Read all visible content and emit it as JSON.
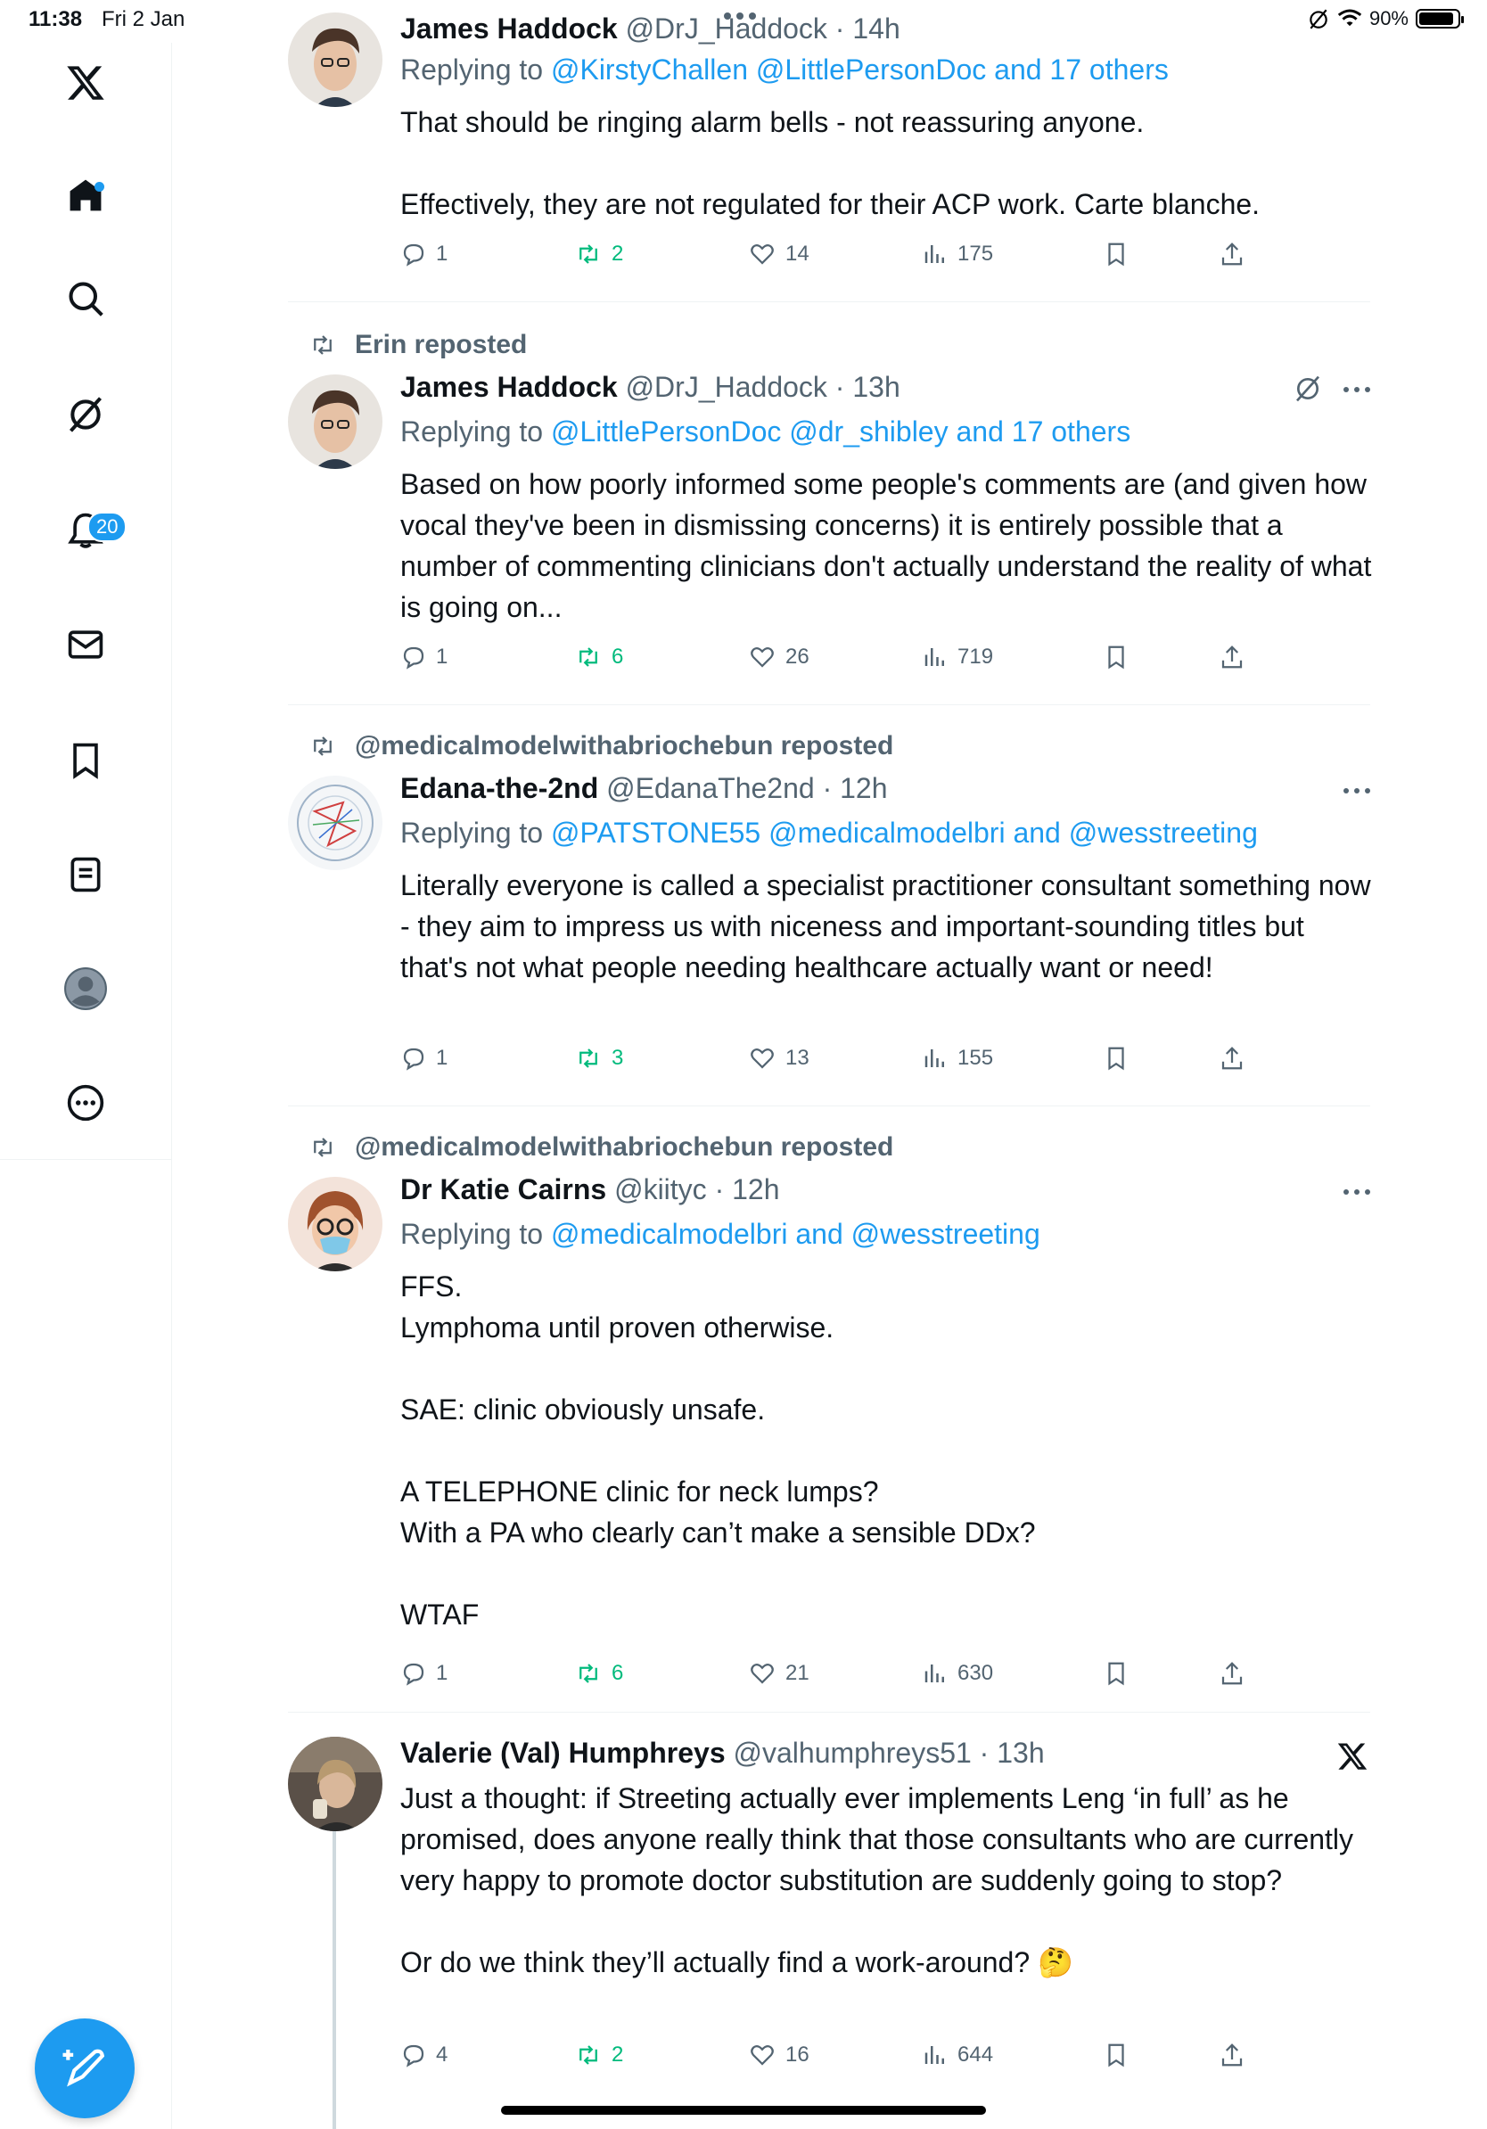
{
  "status_bar": {
    "time": "11:38",
    "date": "Fri 2 Jan",
    "battery": "90%"
  },
  "sidebar": {
    "notifications_badge": "20",
    "items": [
      {
        "name": "x-logo-icon"
      },
      {
        "name": "home-icon"
      },
      {
        "name": "search-icon"
      },
      {
        "name": "grok-icon"
      },
      {
        "name": "notifications-icon"
      },
      {
        "name": "messages-icon"
      },
      {
        "name": "bookmarks-icon"
      },
      {
        "name": "lists-icon"
      },
      {
        "name": "profile-icon"
      },
      {
        "name": "more-icon"
      }
    ],
    "compose_icon": "compose-icon"
  },
  "tweets": [
    {
      "name": "James Haddock",
      "handle": "@DrJ_Haddock",
      "time": "14h",
      "reply_prefix": "Replying to",
      "reply_mentions": "@KirstyChallen @LittlePersonDoc and 17 others",
      "text": "That should be ringing alarm bells - not reassuring anyone.\n\nEffectively, they are not regulated for their ACP work. Carte blanche.",
      "replies": "1",
      "reposts": "2",
      "likes": "14",
      "views": "175"
    },
    {
      "repost_by": "Erin reposted",
      "name": "James Haddock",
      "handle": "@DrJ_Haddock",
      "time": "13h",
      "reply_prefix": "Replying to",
      "reply_mentions": "@LittlePersonDoc @dr_shibley and 17 others",
      "text": "Based on how poorly informed some people's comments are (and given how vocal they've been in dismissing concerns) it is entirely possible that a number of commenting clinicians don't actually understand the reality of what is going on...",
      "replies": "1",
      "reposts": "6",
      "likes": "26",
      "views": "719"
    },
    {
      "repost_by": "@medicalmodelwithabriochebun reposted",
      "name": "Edana-the-2nd",
      "handle": "@EdanaThe2nd",
      "time": "12h",
      "reply_prefix": "Replying to",
      "reply_mentions": "@PATSTONE55 @medicalmodelbri and @wesstreeting",
      "text": "Literally everyone is called a specialist practitioner consultant something now - they aim to impress us with niceness and important-sounding titles but that's not what people needing healthcare actually want or need!",
      "replies": "1",
      "reposts": "3",
      "likes": "13",
      "views": "155"
    },
    {
      "repost_by": "@medicalmodelwithabriochebun reposted",
      "name": "Dr Katie Cairns",
      "handle": "@kiityc",
      "time": "12h",
      "reply_prefix": "Replying to",
      "reply_mentions": "@medicalmodelbri and @wesstreeting",
      "text": "FFS.\nLymphoma until proven otherwise.\n\nSAE: clinic obviously unsafe.\n\nA TELEPHONE clinic for neck lumps?\nWith a PA who clearly can’t make a sensible DDx?\n\nWTAF",
      "replies": "1",
      "reposts": "6",
      "likes": "21",
      "views": "630"
    },
    {
      "name": "Valerie (Val) Humphreys",
      "handle": "@valhumphreys51",
      "time": "13h",
      "text": "Just a thought: if Streeting actually ever implements Leng ‘in full’ as he promised, does anyone really think that those consultants who are currently very happy to promote doctor substitution are suddenly going to stop?\n\nOr do we think they’ll actually find a work-around? 🤔",
      "replies": "4",
      "reposts": "2",
      "likes": "16",
      "views": "644"
    }
  ],
  "colors": {
    "accent": "#1d9bf0",
    "repost_green": "#00ba7c",
    "secondary_text": "#536471"
  }
}
